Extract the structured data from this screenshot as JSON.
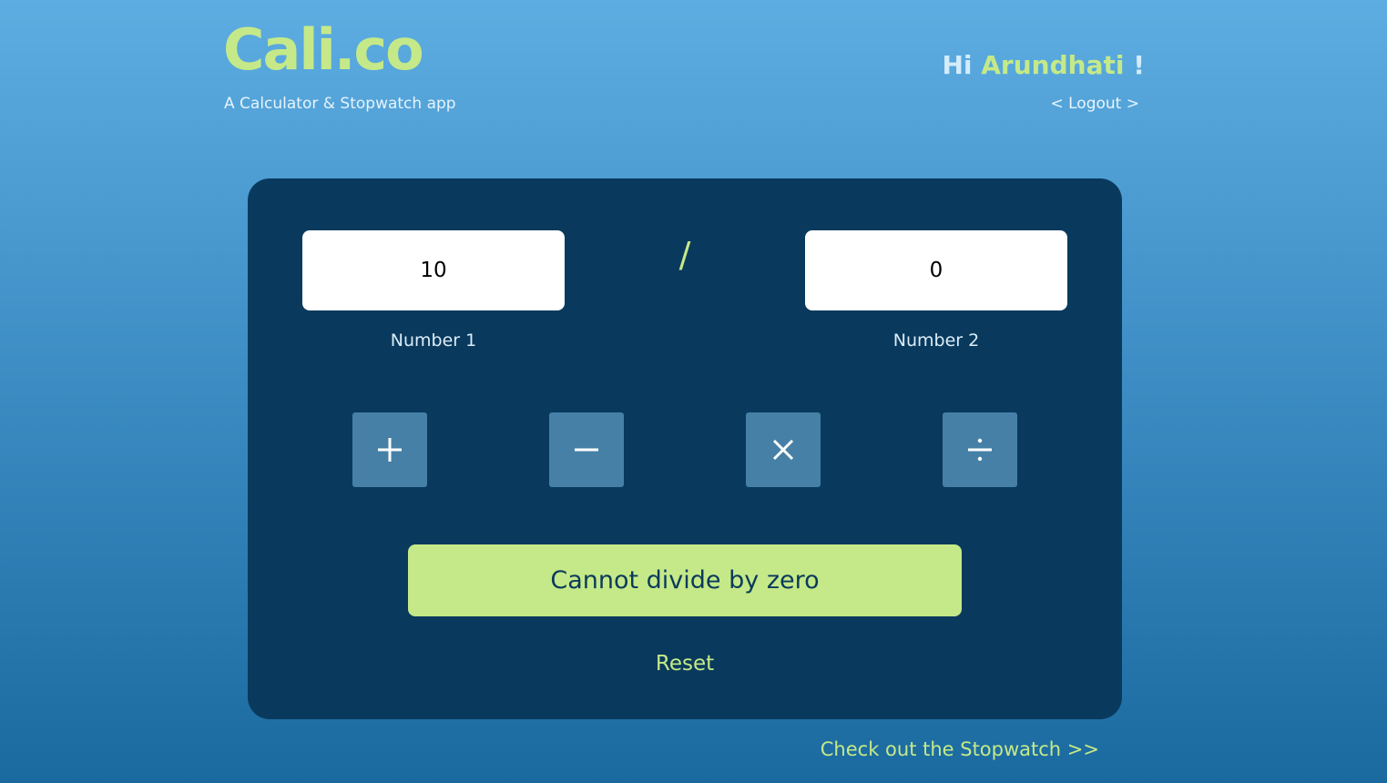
{
  "header": {
    "logo_text": "Cali.co",
    "tagline": "A Calculator & Stopwatch app",
    "greeting_prefix": "Hi",
    "user_name": "Arundhati",
    "greeting_suffix": "!",
    "logout_label": "< Logout >"
  },
  "calculator": {
    "number1_value": "10",
    "number1_label": "Number 1",
    "operator_symbol": "/",
    "number2_value": "0",
    "number2_label": "Number 2",
    "buttons": [
      {
        "icon": "plus-icon"
      },
      {
        "icon": "minus-icon"
      },
      {
        "icon": "multiply-icon"
      },
      {
        "icon": "divide-icon"
      }
    ],
    "result_text": "Cannot divide by zero",
    "reset_label": "Reset"
  },
  "footer": {
    "stopwatch_link": "Check out the Stopwatch >>"
  },
  "colors": {
    "accent": "#c5e988",
    "card_bg": "#093a5d",
    "button_bg": "#4680a6"
  }
}
